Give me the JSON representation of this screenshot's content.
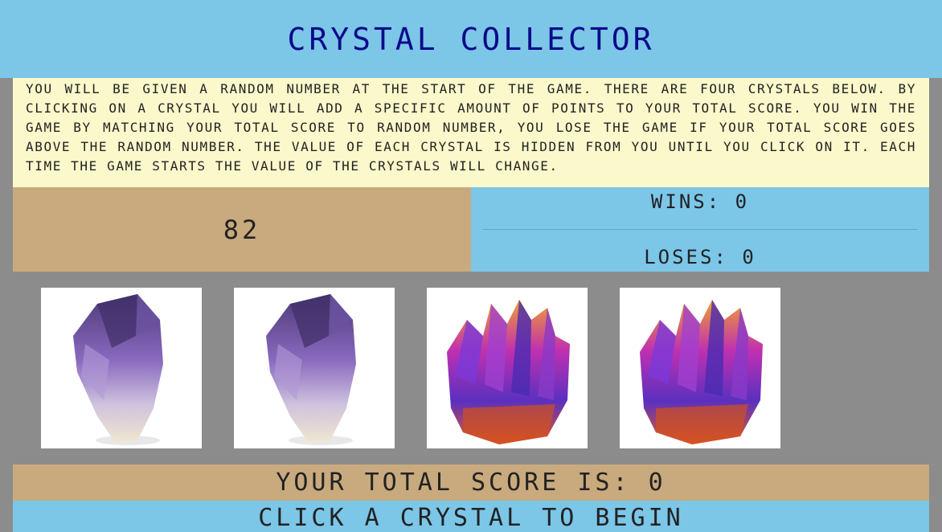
{
  "header": {
    "title": "Crystal Collector"
  },
  "instructions": {
    "text": "You will be given a random number at the start of the game. There are four crystals below. By clicking on a crystal you will add a specific amount of points to your total score. You win the game by matching your total score to random number, you lose the game if your total score goes above the random number. The value of each crystal is hidden from you until you click on it. Each time the game starts the value of the crystals will change."
  },
  "game": {
    "random_number": "82",
    "wins": "Wins: 0",
    "loses": "Loses: 0",
    "total_score": "Your total score is: 0",
    "status": "Click a crystal to begin"
  },
  "crystals": [
    {
      "icon": "amethyst-crystal-icon"
    },
    {
      "icon": "amethyst-crystal-icon"
    },
    {
      "icon": "aura-quartz-crystal-icon"
    },
    {
      "icon": "aura-quartz-crystal-icon"
    }
  ],
  "colors": {
    "header_bg": "#7cc6e8",
    "title": "#0a0a8a",
    "instructions_bg": "#fbf8cb",
    "tan": "#c9aa7e",
    "page_bg": "#8c8c8c"
  }
}
